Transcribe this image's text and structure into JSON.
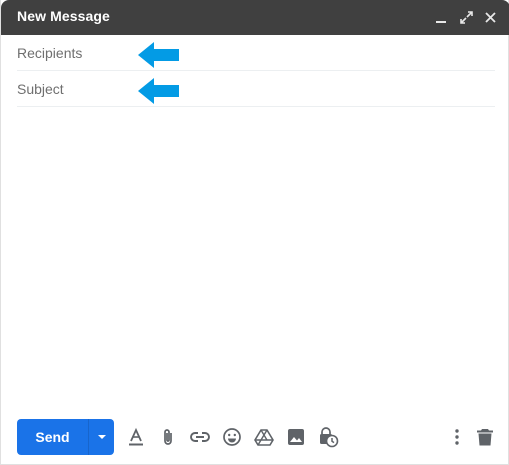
{
  "window": {
    "title": "New Message",
    "minimize_icon": "minimize-icon",
    "fullscreen_icon": "expand-icon",
    "close_icon": "close-icon"
  },
  "recipients": {
    "placeholder": "Recipients",
    "value": ""
  },
  "subject": {
    "placeholder": "Subject",
    "value": ""
  },
  "body": {
    "value": ""
  },
  "annotation_color": "#039be5",
  "toolbar": {
    "send_label": "Send",
    "send_color": "#1a73e8",
    "icons": [
      "formatting-icon",
      "attach-icon",
      "link-icon",
      "emoji-icon",
      "drive-icon",
      "photo-icon",
      "confidential-mode-icon",
      "more-options-icon",
      "trash-icon"
    ]
  }
}
